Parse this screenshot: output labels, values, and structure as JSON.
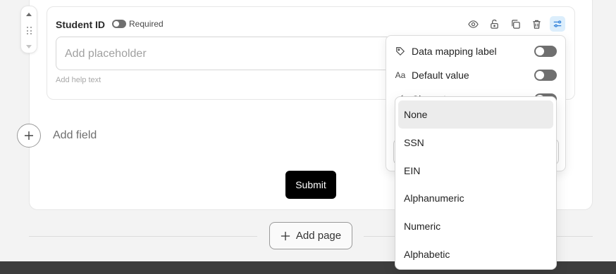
{
  "field": {
    "label": "Student ID",
    "required_label": "Required",
    "placeholder": "Add placeholder",
    "help_text": "Add help text"
  },
  "toolbar": {
    "icons": [
      "eye-icon",
      "unlock-icon",
      "copy-icon",
      "trash-icon",
      "sliders-icon"
    ]
  },
  "add_field": {
    "label": "Add field"
  },
  "submit": {
    "label": "Submit"
  },
  "add_page": {
    "label": "Add page"
  },
  "settings_panel": {
    "rows": [
      {
        "label": "Data mapping label",
        "icon": "tag-icon",
        "enabled": false
      },
      {
        "label": "Default value",
        "icon": "text-size-icon",
        "enabled": false
      },
      {
        "label": "Character",
        "icon": "pen-icon",
        "enabled": false
      }
    ]
  },
  "dropdown": {
    "selected": "None",
    "options": [
      "None",
      "SSN",
      "EIN",
      "Alphanumeric",
      "Numeric",
      "Alphabetic"
    ]
  },
  "colors": {
    "accent_bg": "#dceefc",
    "accent": "#2f7fd8",
    "submit_bg": "#000000"
  }
}
